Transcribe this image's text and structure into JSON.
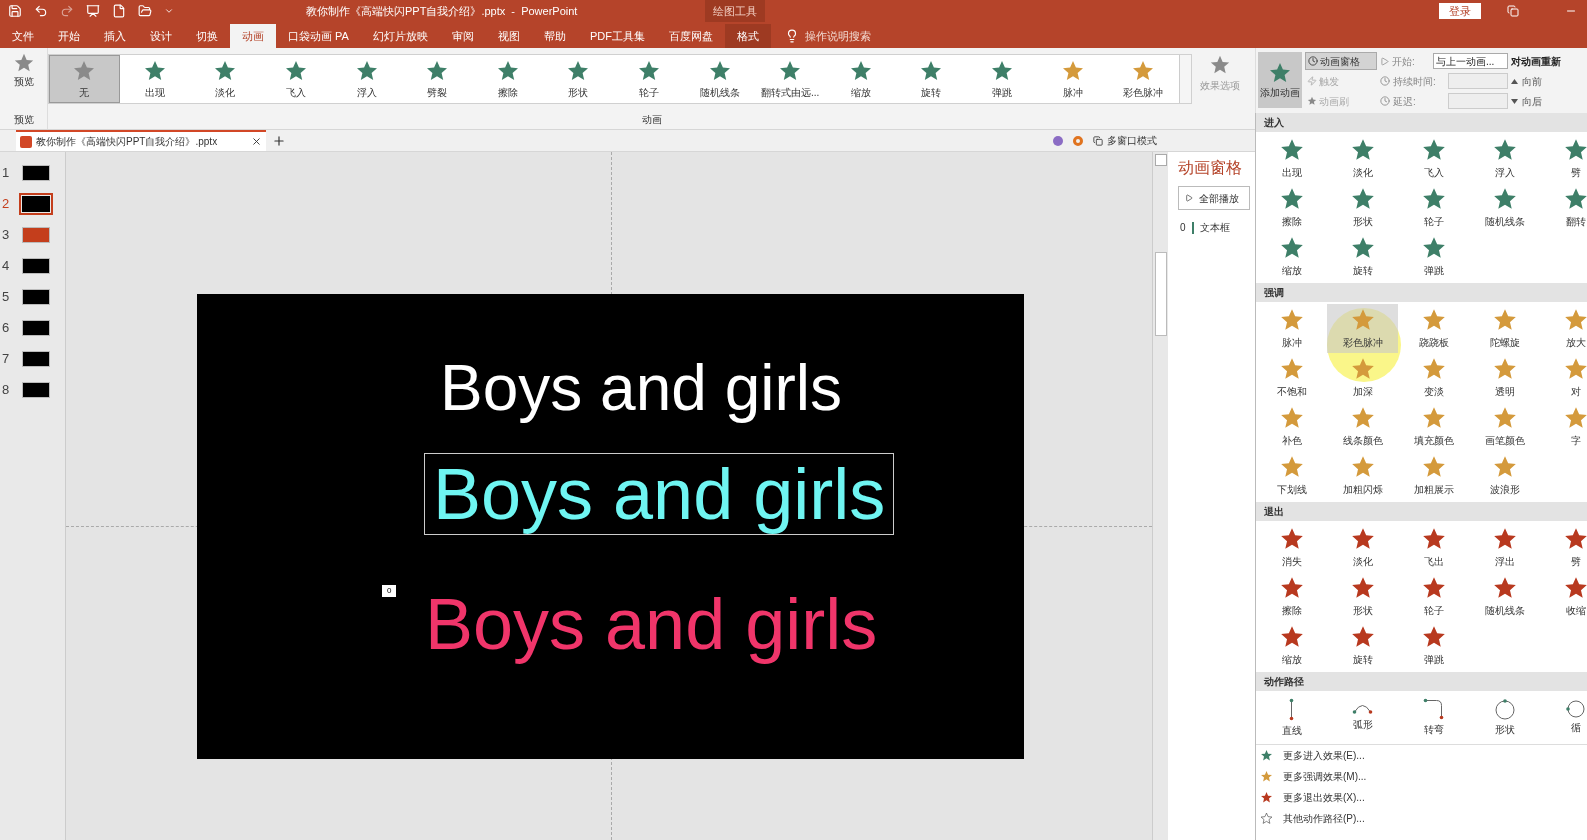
{
  "title_bar": {
    "title": "教你制作《高端快闪PPT自我介绍》.pptx  -  PowerPoint",
    "context_label": "绘图工具",
    "login": "登录"
  },
  "tabs": [
    {
      "label": "文件",
      "selected": false
    },
    {
      "label": "开始",
      "selected": false
    },
    {
      "label": "插入",
      "selected": false
    },
    {
      "label": "设计",
      "selected": false
    },
    {
      "label": "切换",
      "selected": false
    },
    {
      "label": "动画",
      "selected": true
    },
    {
      "label": "口袋动画 PA",
      "selected": false
    },
    {
      "label": "幻灯片放映",
      "selected": false
    },
    {
      "label": "审阅",
      "selected": false
    },
    {
      "label": "视图",
      "selected": false
    },
    {
      "label": "帮助",
      "selected": false
    },
    {
      "label": "PDF工具集",
      "selected": false
    },
    {
      "label": "百度网盘",
      "selected": false
    },
    {
      "label": "格式",
      "selected": false
    }
  ],
  "search": {
    "placeholder": "操作说明搜索"
  },
  "ribbon": {
    "preview": "预览",
    "preview_group": "预览",
    "group_label": "动画",
    "effect_options": "效果选项",
    "gallery": [
      {
        "label": "无",
        "kind": "none",
        "selected": true
      },
      {
        "label": "出现",
        "kind": "entrance",
        "selected": false
      },
      {
        "label": "淡化",
        "kind": "entrance",
        "selected": false
      },
      {
        "label": "飞入",
        "kind": "entrance",
        "selected": false
      },
      {
        "label": "浮入",
        "kind": "entrance",
        "selected": false
      },
      {
        "label": "劈裂",
        "kind": "entrance",
        "selected": false
      },
      {
        "label": "擦除",
        "kind": "entrance",
        "selected": false
      },
      {
        "label": "形状",
        "kind": "entrance",
        "selected": false
      },
      {
        "label": "轮子",
        "kind": "entrance",
        "selected": false
      },
      {
        "label": "随机线条",
        "kind": "entrance",
        "selected": false
      },
      {
        "label": "翻转式由远...",
        "kind": "entrance",
        "selected": false
      },
      {
        "label": "缩放",
        "kind": "entrance",
        "selected": false
      },
      {
        "label": "旋转",
        "kind": "entrance",
        "selected": false
      },
      {
        "label": "弹跳",
        "kind": "entrance",
        "selected": false
      },
      {
        "label": "脉冲",
        "kind": "emphasis",
        "selected": false
      },
      {
        "label": "彩色脉冲",
        "kind": "emphasis",
        "selected": false
      }
    ],
    "add_animation": {
      "label": "添加动画",
      "pressed": true
    },
    "pane_button": {
      "label": "动画窗格",
      "pressed": true
    },
    "trigger": {
      "label": "触发",
      "disabled": true
    },
    "painter": {
      "label": "动画刷",
      "disabled": true
    },
    "start": {
      "label": "开始:",
      "value": "与上一动画..."
    },
    "duration": {
      "label": "持续时间:",
      "disabled": true
    },
    "delay": {
      "label": "延迟:",
      "disabled": true
    },
    "reorder": {
      "label": "对动画重新",
      "forward": "向前",
      "backward": "向后"
    }
  },
  "document_tab": {
    "title": "教你制作《高端快闪PPT自我介绍》.pptx"
  },
  "multi_window": "多窗口模式",
  "slides": [
    {
      "number": "1",
      "selected": false
    },
    {
      "number": "2",
      "selected": true
    },
    {
      "number": "3",
      "selected": false
    },
    {
      "number": "4",
      "selected": false
    },
    {
      "number": "5",
      "selected": false
    },
    {
      "number": "6",
      "selected": false
    },
    {
      "number": "7",
      "selected": false
    },
    {
      "number": "8",
      "selected": false
    }
  ],
  "slide": {
    "lines": [
      {
        "text": "Boys and girls",
        "color": "#ffffff",
        "selected": false
      },
      {
        "text": "Boys and girls",
        "color": "#6ff5f2",
        "selected": true
      },
      {
        "text": "Boys and girls",
        "color": "#f0356a",
        "selected": false
      }
    ],
    "tag": "0"
  },
  "animation_pane": {
    "title": "动画窗格",
    "play_all": "全部播放",
    "items": [
      {
        "number": "0",
        "label": "文本框"
      }
    ]
  },
  "effects_menu": {
    "sections": [
      {
        "title": "进入",
        "kind": "entrance",
        "items": [
          {
            "label": "出现",
            "hovered": false
          },
          {
            "label": "淡化",
            "hovered": false
          },
          {
            "label": "飞入",
            "hovered": false
          },
          {
            "label": "浮入",
            "hovered": false
          },
          {
            "label": "劈",
            "hovered": false
          },
          {
            "label": "擦除",
            "hovered": false
          },
          {
            "label": "形状",
            "hovered": false
          },
          {
            "label": "轮子",
            "hovered": false
          },
          {
            "label": "随机线条",
            "hovered": false
          },
          {
            "label": "翻转",
            "hovered": false
          },
          {
            "label": "缩放",
            "hovered": false
          },
          {
            "label": "旋转",
            "hovered": false
          },
          {
            "label": "弹跳",
            "hovered": false
          }
        ]
      },
      {
        "title": "强调",
        "kind": "emphasis",
        "items": [
          {
            "label": "脉冲",
            "hovered": false
          },
          {
            "label": "彩色脉冲",
            "hovered": true
          },
          {
            "label": "跷跷板",
            "hovered": false
          },
          {
            "label": "陀螺旋",
            "hovered": false
          },
          {
            "label": "放大",
            "hovered": false
          },
          {
            "label": "不饱和",
            "hovered": false
          },
          {
            "label": "加深",
            "hovered": false
          },
          {
            "label": "变淡",
            "hovered": false
          },
          {
            "label": "透明",
            "hovered": false
          },
          {
            "label": "对",
            "hovered": false
          },
          {
            "label": "补色",
            "hovered": false
          },
          {
            "label": "线条颜色",
            "hovered": false
          },
          {
            "label": "填充颜色",
            "hovered": false
          },
          {
            "label": "画笔颜色",
            "hovered": false
          },
          {
            "label": "字",
            "hovered": false
          },
          {
            "label": "下划线",
            "hovered": false
          },
          {
            "label": "加粗闪烁",
            "hovered": false
          },
          {
            "label": "加粗展示",
            "hovered": false
          },
          {
            "label": "波浪形",
            "hovered": false
          }
        ]
      },
      {
        "title": "退出",
        "kind": "exit",
        "items": [
          {
            "label": "消失",
            "hovered": false
          },
          {
            "label": "淡化",
            "hovered": false
          },
          {
            "label": "飞出",
            "hovered": false
          },
          {
            "label": "浮出",
            "hovered": false
          },
          {
            "label": "劈",
            "hovered": false
          },
          {
            "label": "擦除",
            "hovered": false
          },
          {
            "label": "形状",
            "hovered": false
          },
          {
            "label": "轮子",
            "hovered": false
          },
          {
            "label": "随机线条",
            "hovered": false
          },
          {
            "label": "收缩",
            "hovered": false
          },
          {
            "label": "缩放",
            "hovered": false
          },
          {
            "label": "旋转",
            "hovered": false
          },
          {
            "label": "弹跳",
            "hovered": false
          }
        ]
      },
      {
        "title": "动作路径",
        "kind": "path",
        "items": [
          {
            "label": "直线",
            "hovered": false
          },
          {
            "label": "弧形",
            "hovered": false
          },
          {
            "label": "转弯",
            "hovered": false
          },
          {
            "label": "形状",
            "hovered": false
          },
          {
            "label": "循",
            "hovered": false
          }
        ]
      }
    ],
    "more": [
      {
        "label": "更多进入效果(E)...",
        "kind": "entrance"
      },
      {
        "label": "更多强调效果(M)...",
        "kind": "emphasis"
      },
      {
        "label": "更多退出效果(X)...",
        "kind": "exit"
      },
      {
        "label": "其他动作路径(P)...",
        "kind": "path"
      }
    ]
  }
}
